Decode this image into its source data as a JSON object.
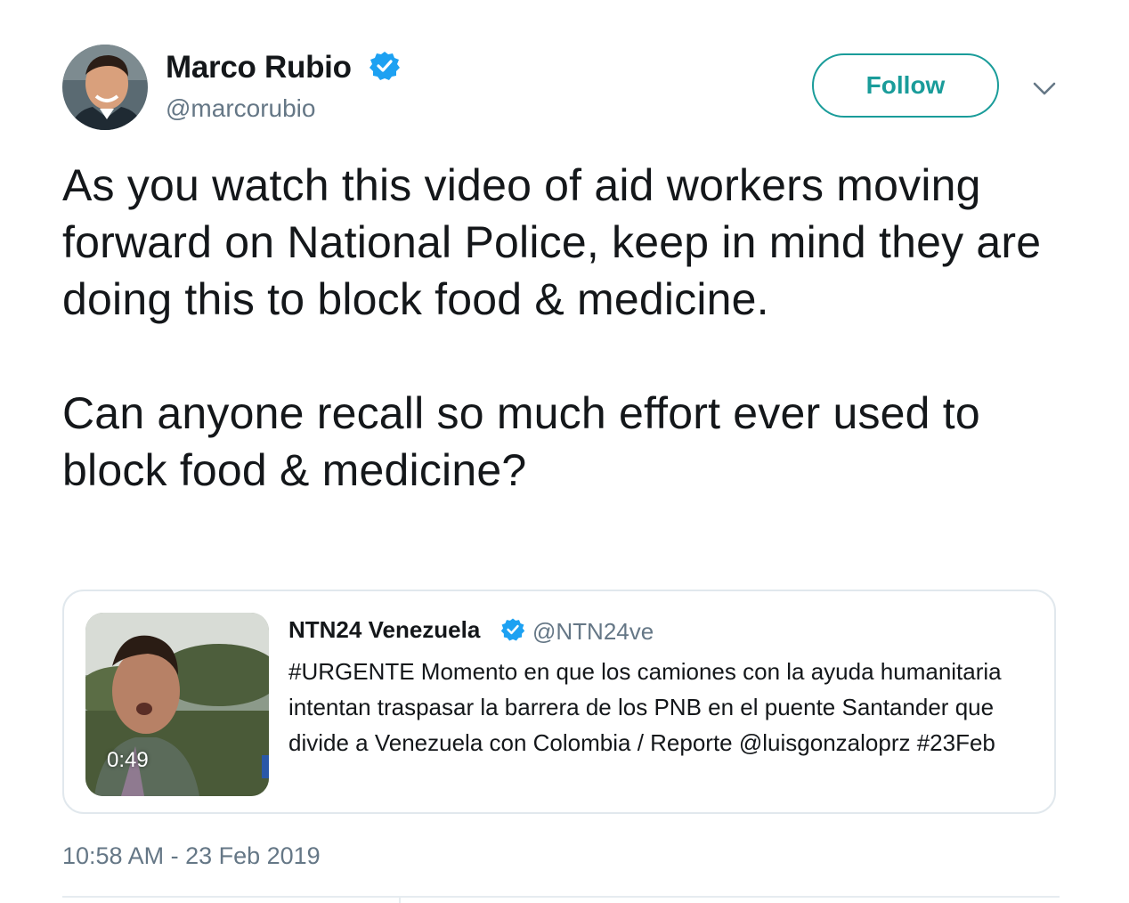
{
  "tweet": {
    "author": {
      "name": "Marco Rubio",
      "handle": "@marcorubio",
      "verified": true,
      "avatar_icon": "profile-photo"
    },
    "follow_label": "Follow",
    "menu_icon": "chevron-down-icon",
    "text": "As you watch this video of aid workers moving forward on National Police, keep in mind they are doing this to block food & medicine.\n\nCan anyone recall so much effort ever used to block food & medicine?",
    "timestamp": "10:58 AM - 23 Feb 2019"
  },
  "quoted_tweet": {
    "author_name": "NTN24 Venezuela",
    "author_handle": "@NTN24ve",
    "verified": true,
    "video_duration": "0:49",
    "text": "#URGENTE Momento en que los camiones con la ayuda humanitaria intentan traspasar la barrera de los PNB en el puente Santander que divide a Venezuela con Colombia / Reporte @luisgonzaloprz #23Feb"
  },
  "colors": {
    "accent": "#1a9c9a",
    "verified_blue": "#1da1f2",
    "secondary_text": "#657786",
    "primary_text": "#14171a",
    "border": "#e1e8ed"
  }
}
